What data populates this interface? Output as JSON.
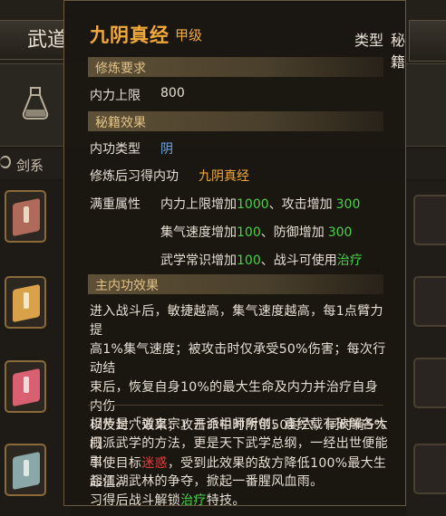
{
  "background": {
    "tab_left": "武道",
    "filter_label": "剑系",
    "books": [
      {
        "color": "#b06a5a"
      },
      {
        "color": "#d9a24a"
      },
      {
        "color": "#d86070"
      },
      {
        "color": "#8aa8a8"
      }
    ]
  },
  "tooltip": {
    "title": "九阴真经",
    "grade": "甲级",
    "type_label": "类型",
    "type_value": "秘籍",
    "sections": {
      "requirements": "修炼要求",
      "effects": "秘籍效果",
      "main_effect": "主内功效果"
    },
    "req": {
      "label": "内力上限",
      "value": "800"
    },
    "effect_rows": {
      "type_label": "内功类型",
      "type_value": "阴",
      "learn_label": "修炼后习得内功",
      "learn_value": "九阴真经"
    },
    "full_attr": {
      "label": "满重属性",
      "line1": {
        "a": "内力上限增加",
        "a_val": "1000",
        "sep": "、",
        "b": "攻击增加",
        "b_val": "300"
      },
      "line2": {
        "a": "集气速度增加",
        "a_val": "100",
        "sep": "、",
        "b": "防御增加",
        "b_val": "300"
      },
      "line3": {
        "a": "武学常识增加",
        "a_val": "100",
        "sep": "、",
        "b": "战斗可使用",
        "b_val": "治疗"
      }
    },
    "main_effect_text": {
      "l1": "进入战斗后，敏捷越高，集气速度越高，每1点臂力提",
      "l2": "高1%集气速度；被攻击时仅承受50%伤害；每次行动结",
      "l3": "束后，恢复自身10%的最大生命及内力并治疗自身内伤",
      "l4": "以及封穴效果；攻击命中时附带50封穴，同时有5%概",
      "l5a": "率使目标",
      "l5b": "迷惑",
      "l5c": "，受到此效果的敌方降低100%最大生",
      "l6": "命值。"
    },
    "lore": {
      "l1": "相传是「道玄宗」开派祖师所创，真经载有破解各大",
      "l2": "门派武学的方法，更是天下武学总纲，一经出世便能引",
      "l3": "起江湖武林的争夺，掀起一番腥风血雨。",
      "l4a": "习得后战斗解锁",
      "l4b": "治疗",
      "l4c": "特技。"
    }
  },
  "colors": {
    "title": "#f2a93c",
    "section_text": "#e2c287",
    "blue": "#6ea9ea",
    "green": "#48d346",
    "red": "#e04040"
  }
}
